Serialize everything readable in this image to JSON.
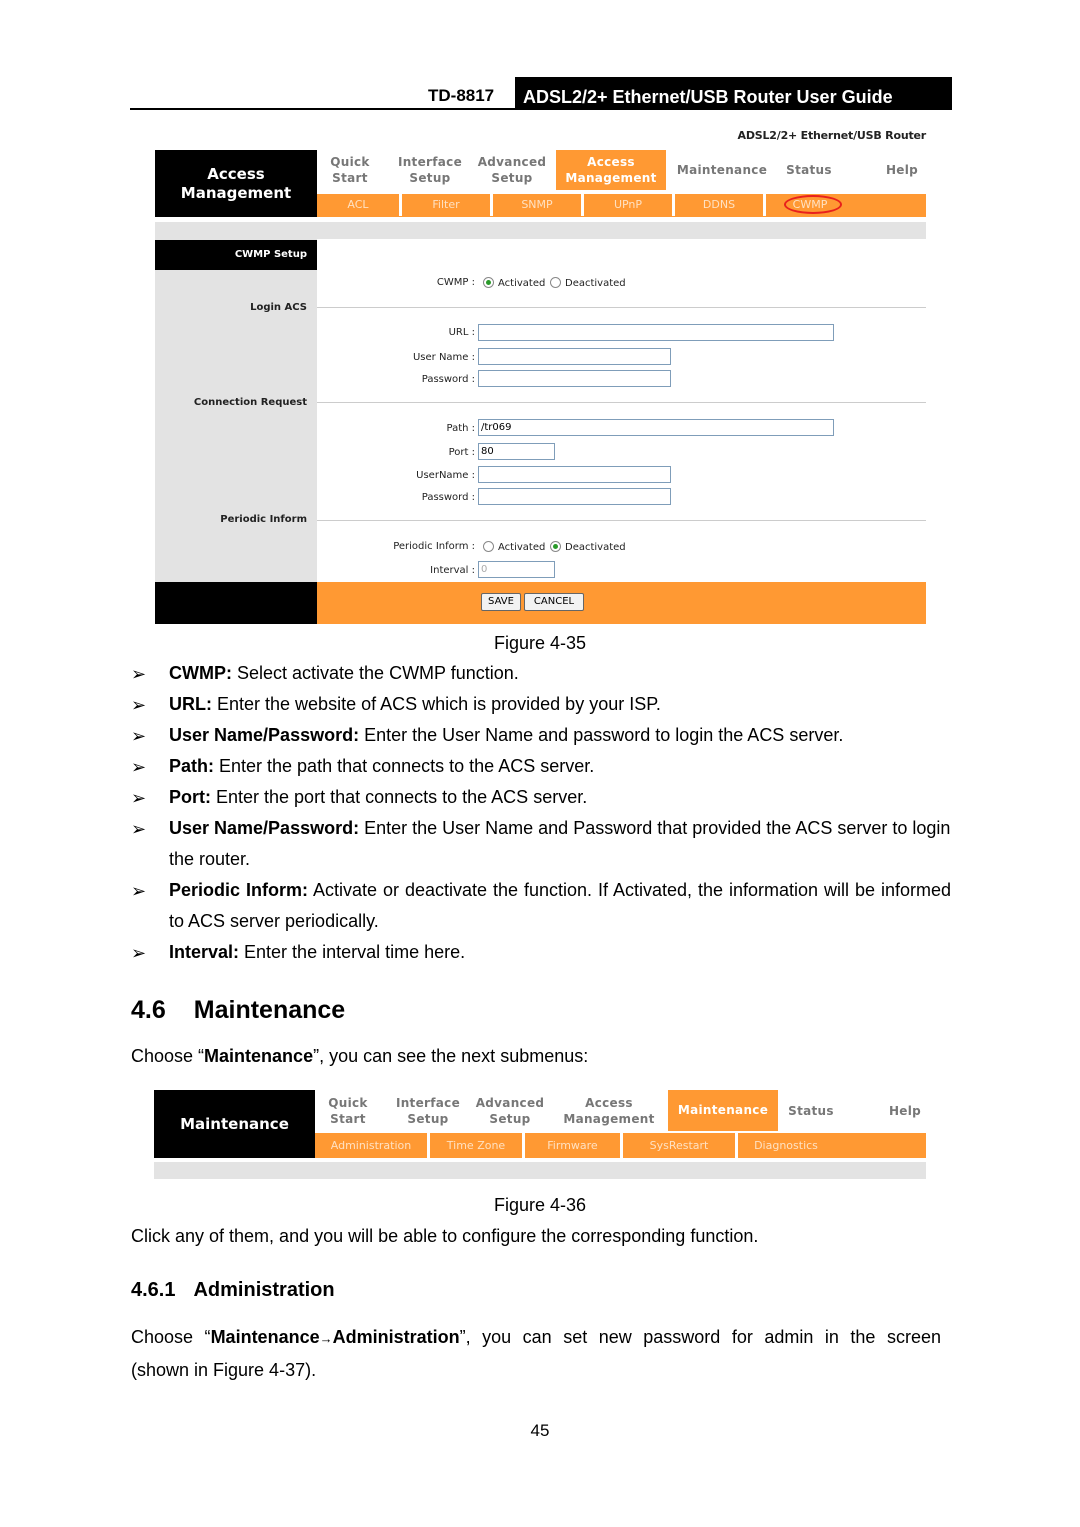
{
  "page_header": {
    "model": "TD-8817",
    "title": "ADSL2/2+  Ethernet/USB  Router  User  Guide"
  },
  "figure_35": {
    "brand": "ADSL2/2+ Ethernet/USB Router",
    "section_title": [
      "Access",
      "Management"
    ],
    "menu": [
      {
        "line1": "Quick",
        "line2": "Start",
        "active": false
      },
      {
        "line1": "Interface",
        "line2": "Setup",
        "active": false
      },
      {
        "line1": "Advanced",
        "line2": "Setup",
        "active": false
      },
      {
        "line1": "Access",
        "line2": "Management",
        "active": true
      },
      {
        "line1": "Maintenance",
        "line2": "",
        "active": false
      },
      {
        "line1": "Status",
        "line2": "",
        "active": false
      },
      {
        "line1": "Help",
        "line2": "",
        "active": false
      }
    ],
    "submenu": [
      "ACL",
      "Filter",
      "SNMP",
      "UPnP",
      "DDNS",
      "CWMP"
    ],
    "submenu_highlighted": "CWMP",
    "highlight_color": "#e8201c",
    "left_sections": {
      "setup": "CWMP Setup",
      "login": "Login ACS",
      "conn": "Connection Request",
      "periodic": "Periodic Inform"
    },
    "cwmp": {
      "label": "CWMP :",
      "opt_on": "Activated",
      "opt_off": "Deactivated",
      "selected": "Activated"
    },
    "login_acs": {
      "url_label": "URL :",
      "url_value": "",
      "user_label": "User Name :",
      "user_value": "",
      "pass_label": "Password :",
      "pass_value": ""
    },
    "conn_req": {
      "path_label": "Path :",
      "path_value": "/tr069",
      "port_label": "Port :",
      "port_value": "80",
      "user_label": "UserName :",
      "user_value": "",
      "pass_label": "Password :",
      "pass_value": ""
    },
    "periodic": {
      "label": "Periodic Inform :",
      "opt_on": "Activated",
      "opt_off": "Deactivated",
      "selected": "Deactivated",
      "interval_label": "Interval :",
      "interval_value": "0"
    },
    "buttons": {
      "save": "SAVE",
      "cancel": "CANCEL"
    },
    "caption": "Figure 4-35"
  },
  "bullets": [
    {
      "bold": "CWMP:",
      "text": " Select activate the CWMP function."
    },
    {
      "bold": "URL:",
      "text": " Enter the website of ACS which is provided by your ISP."
    },
    {
      "bold": "User Name/Password:",
      "text": " Enter the User Name and password to login the ACS server."
    },
    {
      "bold": "Path:",
      "text": " Enter the path that connects to the ACS server."
    },
    {
      "bold": "Port:",
      "text": " Enter the port that connects to the ACS server."
    },
    {
      "bold": "User Name/Password:",
      "text": " Enter the User Name and Password that provided the ACS server to login the router."
    },
    {
      "bold": "Periodic Inform:",
      "text": " Activate or deactivate the function. If Activated, the information will be informed to ACS server periodically."
    },
    {
      "bold": "Interval:",
      "text": " Enter the interval time here."
    }
  ],
  "bullet_glyph": "➢",
  "section_46": {
    "number": "4.6",
    "title": "Maintenance",
    "intro_pre": "Choose “",
    "intro_bold": "Maintenance",
    "intro_post": "”, you can see the next submenus:"
  },
  "figure_36": {
    "section_title": "Maintenance",
    "menu": [
      {
        "line1": "Quick",
        "line2": "Start",
        "active": false
      },
      {
        "line1": "Interface",
        "line2": "Setup",
        "active": false
      },
      {
        "line1": "Advanced",
        "line2": "Setup",
        "active": false
      },
      {
        "line1": "Access",
        "line2": "Management",
        "active": false
      },
      {
        "line1": "Maintenance",
        "line2": "",
        "active": true
      },
      {
        "line1": "Status",
        "line2": "",
        "active": false
      },
      {
        "line1": "Help",
        "line2": "",
        "active": false
      }
    ],
    "submenu": [
      "Administration",
      "Time Zone",
      "Firmware",
      "SysRestart",
      "Diagnostics"
    ],
    "caption": "Figure 4-36"
  },
  "after_fig36": "Click any of them, and you will be able to configure the corresponding function.",
  "section_461": {
    "number": "4.6.1",
    "title": "Administration",
    "p_pre": "Choose “",
    "p_bold1": "Maintenance",
    "p_arrow": "→",
    "p_bold2": "Administration",
    "p_post": "”, you can set new password for admin in the screen",
    "p_line2": "(shown in Figure 4-37)."
  },
  "page_number": "45"
}
